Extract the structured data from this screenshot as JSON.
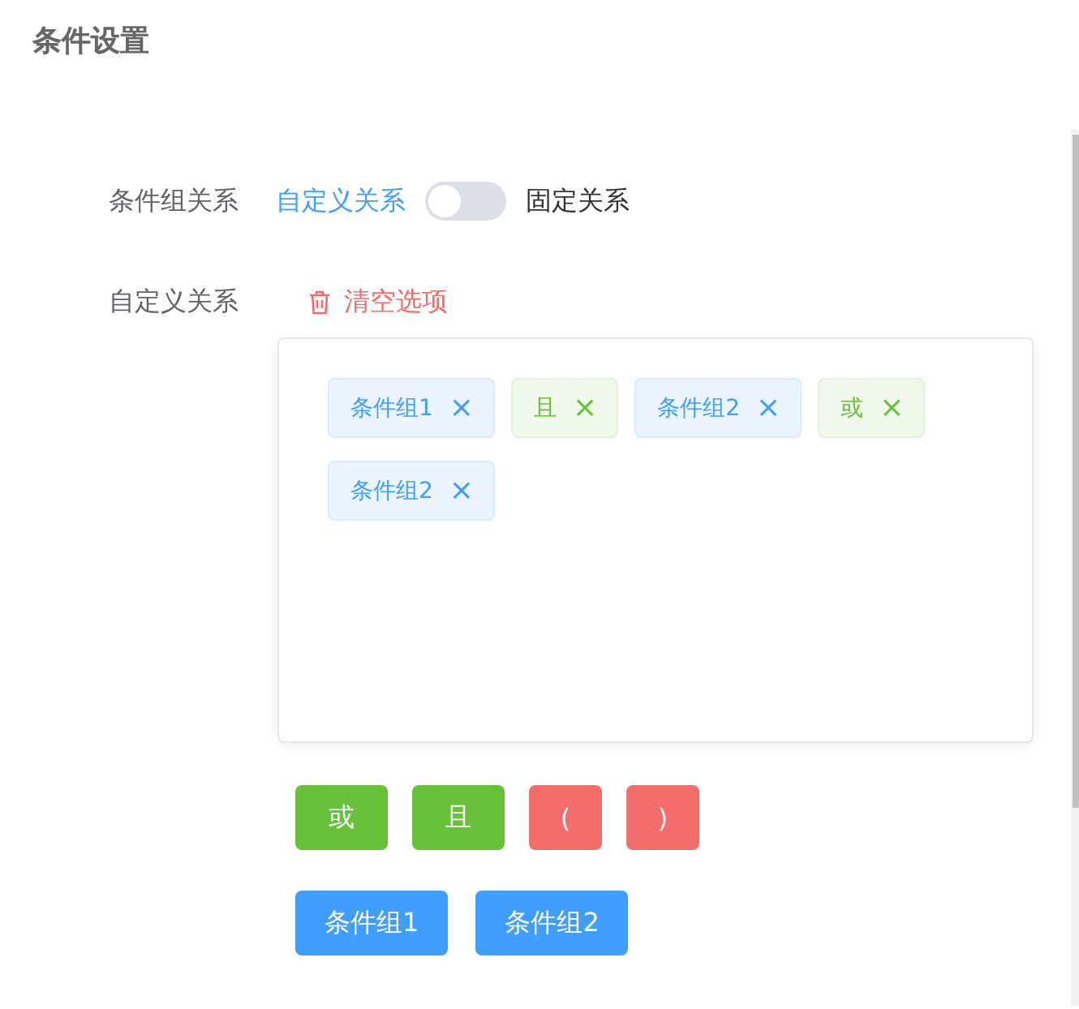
{
  "title": "条件设置",
  "relation_row": {
    "label": "条件组关系",
    "left_option": "自定义关系",
    "switch": {
      "on": false
    },
    "right_option": "固定关系"
  },
  "custom_row": {
    "label": "自定义关系",
    "clear_button": "清空选项"
  },
  "tags": [
    {
      "label": "条件组1",
      "kind": "group",
      "close": "×"
    },
    {
      "label": "且",
      "kind": "operator",
      "close": "×"
    },
    {
      "label": "条件组2",
      "kind": "group",
      "close": "×"
    },
    {
      "label": "或",
      "kind": "operator",
      "close": "×"
    },
    {
      "label": "条件组2",
      "kind": "group",
      "close": "×"
    }
  ],
  "operator_buttons": [
    {
      "label": "或",
      "kind": "operator"
    },
    {
      "label": "且",
      "kind": "operator"
    },
    {
      "label": "(",
      "kind": "bracket"
    },
    {
      "label": ")",
      "kind": "bracket"
    }
  ],
  "group_buttons": [
    {
      "label": "条件组1",
      "kind": "group"
    },
    {
      "label": "条件组2",
      "kind": "group"
    }
  ]
}
